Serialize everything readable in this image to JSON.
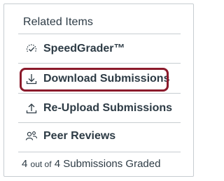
{
  "panel": {
    "title": "Related Items",
    "items": [
      {
        "label": "SpeedGrader™",
        "icon": "speedgrader-icon",
        "highlighted": false
      },
      {
        "label": "Download Submissions",
        "icon": "download-icon",
        "highlighted": true
      },
      {
        "label": "Re-Upload Submissions",
        "icon": "upload-icon",
        "highlighted": false
      },
      {
        "label": "Peer Reviews",
        "icon": "peer-review-icon",
        "highlighted": false
      }
    ],
    "status": {
      "graded_count": "4",
      "out_of": "out of",
      "total_text": "4 Submissions Graded"
    }
  },
  "colors": {
    "text": "#2d3b45",
    "border": "#c7cdd1",
    "highlight": "#8b1a2b"
  }
}
